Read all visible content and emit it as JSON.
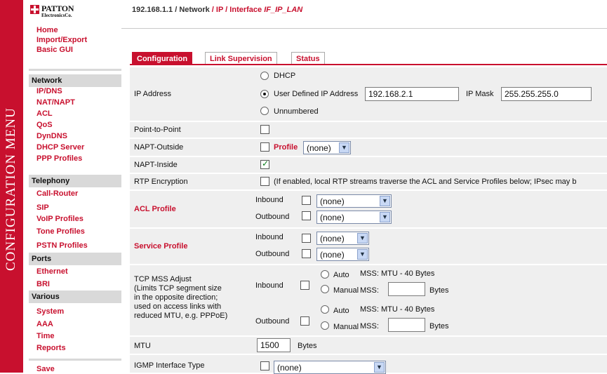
{
  "sidebar": {
    "vertical_title": "CONFIGURATION MENU",
    "logo": {
      "line1": "PATTON",
      "line2": "ElectronicsCo."
    },
    "top_items": [
      "Home",
      "Import/Export",
      "Basic GUI"
    ],
    "sections": [
      {
        "title": "Network",
        "items": [
          "IP/DNS",
          "NAT/NAPT",
          "ACL",
          "QoS",
          "DynDNS",
          "DHCP Server",
          "PPP Profiles"
        ]
      },
      {
        "title": "Telephony",
        "items": [
          "Call-Router",
          "SIP",
          "VoIP Profiles",
          "Tone Profiles",
          "PSTN Profiles"
        ]
      },
      {
        "title": "Ports",
        "items": [
          "Ethernet",
          "BRI"
        ]
      },
      {
        "title": "Various",
        "items": [
          "System",
          "AAA",
          "Time",
          "Reports"
        ]
      }
    ],
    "save_label": "Save"
  },
  "breadcrumb": {
    "host": "192.168.1.1",
    "sep": "/",
    "network": "Network",
    "ip": "IP",
    "iface_label": "Interface",
    "iface_name": "IF_IP_LAN"
  },
  "tabs": [
    "Configuration",
    "Link Supervision",
    "Status"
  ],
  "form": {
    "ip_address_label": "IP Address",
    "dhcp_label": "DHCP",
    "user_defined_label": "User Defined IP Address",
    "ip_value": "192.168.2.1",
    "ip_mask_label": "IP Mask",
    "ip_mask_value": "255.255.255.0",
    "unnumbered_label": "Unnumbered",
    "ptp_label": "Point-to-Point",
    "napt_outside_label": "NAPT-Outside",
    "profile_label": "Profile",
    "none": "(none)",
    "napt_inside_label": "NAPT-Inside",
    "rtp_label": "RTP Encryption",
    "rtp_note": "(If enabled, local RTP streams traverse the ACL and Service Profiles below; IPsec may b",
    "acl_label": "ACL Profile",
    "inbound": "Inbound",
    "outbound": "Outbound",
    "service_label": "Service Profile",
    "tcp_mss_label_lines": [
      "TCP MSS Adjust",
      "(Limits TCP segment size",
      "in the opposite direction;",
      "used on access links with",
      "reduced MTU, e.g. PPPoE)"
    ],
    "auto_label": "Auto",
    "mss_auto_text": "MSS: MTU - 40 Bytes",
    "manual_label": "Manual",
    "mss_label": "MSS:",
    "bytes_label": "Bytes",
    "mtu_label": "MTU",
    "mtu_value": "1500",
    "igmp_label": "IGMP Interface Type"
  }
}
